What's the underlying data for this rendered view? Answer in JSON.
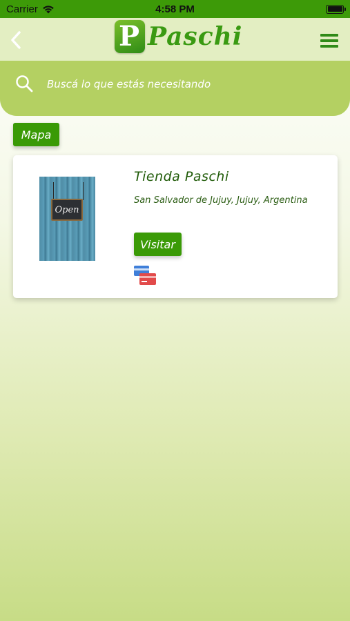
{
  "status_bar": {
    "carrier": "Carrier",
    "time": "4:58 PM"
  },
  "header": {
    "logo_letter": "P",
    "logo_text": "Paschi",
    "back_icon": "chevron-left-icon",
    "menu_icon": "hamburger-menu-icon"
  },
  "search": {
    "placeholder": "Buscá lo que estás necesitando",
    "icon": "search-icon"
  },
  "map_button": {
    "label": "Mapa"
  },
  "store": {
    "name": "Tienda Paschi",
    "address": "San Salvador de Jujuy, Jujuy, Argentina",
    "visit_label": "Visitar",
    "image_sign_text": "Open",
    "payment_icon": "credit-cards-icon"
  },
  "colors": {
    "status_bar": "#3d9a08",
    "header_bg": "#e3eec2",
    "search_bg": "#b4d062",
    "button_green": "#3a9a06",
    "text_dark_green": "#1f5a07"
  }
}
